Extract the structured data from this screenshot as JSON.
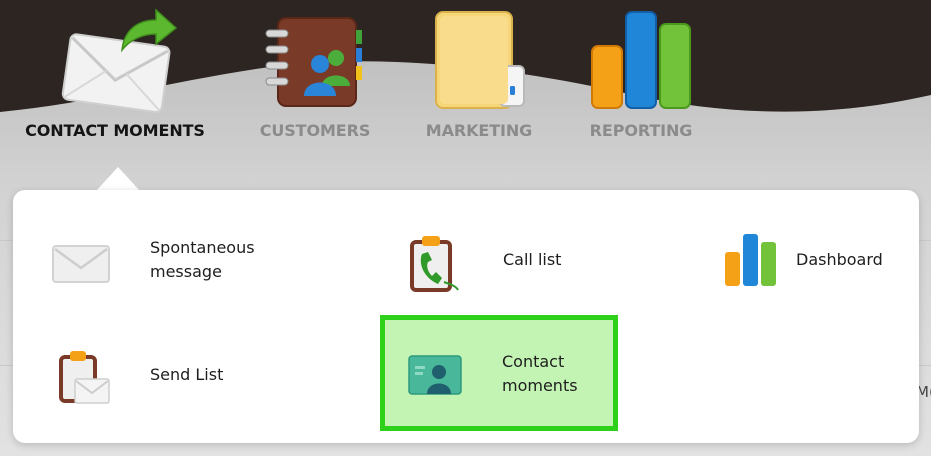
{
  "nav": {
    "items": [
      {
        "label": "CONTACT MOMENTS",
        "icon": "envelope-arrow-icon",
        "active": true
      },
      {
        "label": "CUSTOMERS",
        "icon": "address-book-icon",
        "active": false
      },
      {
        "label": "MARKETING",
        "icon": "folder-icon",
        "active": false
      },
      {
        "label": "REPORTING",
        "icon": "bar-chart-icon",
        "active": false
      }
    ]
  },
  "dropdown": {
    "items": [
      {
        "label": "Spontaneous message",
        "icon": "envelope-icon"
      },
      {
        "label": "Call list",
        "icon": "clipboard-phone-icon"
      },
      {
        "label": "Dashboard",
        "icon": "bar-chart-icon"
      },
      {
        "label": "Send List",
        "icon": "clipboard-envelope-icon"
      },
      {
        "label": "Contact moments",
        "icon": "contact-card-icon",
        "highlighted": true
      }
    ]
  },
  "background_page": {
    "edge_text": "M("
  },
  "colors": {
    "header_dark": "#2c2521",
    "highlight_fill": "#c4f4b4",
    "highlight_border": "#2ed11a",
    "active_label": "#141414",
    "inactive_label": "#8b8b8b"
  }
}
